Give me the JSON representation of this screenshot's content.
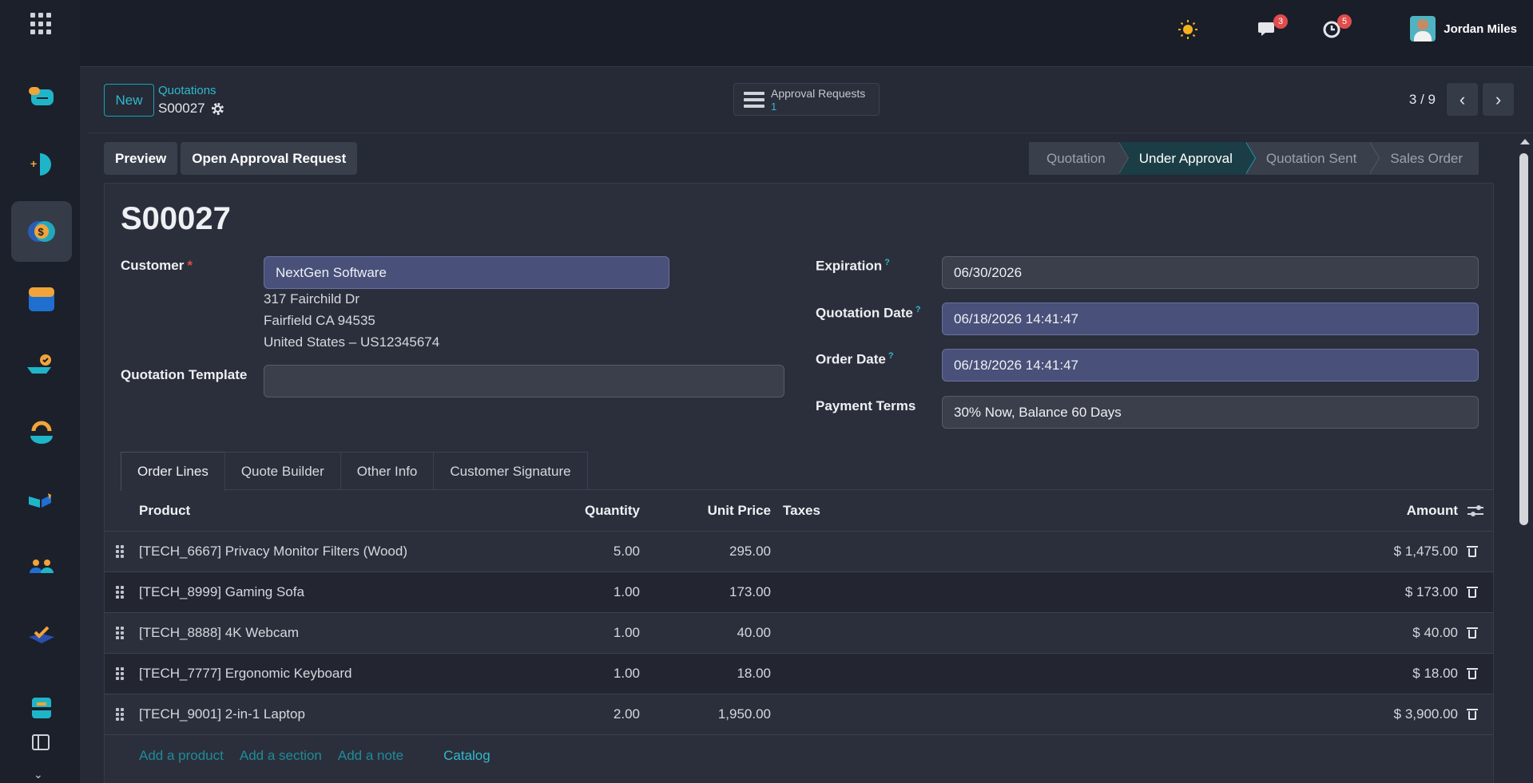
{
  "topbar": {
    "chat_badge": "3",
    "activity_badge": "5",
    "user_name": "Jordan Miles"
  },
  "cpanel": {
    "new_label": "New",
    "breadcrumb_parent": "Quotations",
    "breadcrumb_current": "S00027",
    "approval_label": "Approval Requests",
    "approval_count": "1",
    "pager_value": "3 / 9"
  },
  "actions": {
    "preview": "Preview",
    "open_approval": "Open Approval Request"
  },
  "status": {
    "stages": [
      "Quotation",
      "Under Approval",
      "Quotation Sent",
      "Sales Order"
    ],
    "current": "Under Approval"
  },
  "form": {
    "title": "S00027",
    "customer_label": "Customer",
    "customer_value": "NextGen Software",
    "address_line1": "317 Fairchild Dr",
    "address_line2": "Fairfield CA 94535",
    "address_line3": "United States – US12345674",
    "template_label": "Quotation Template",
    "template_value": "",
    "expiration_label": "Expiration",
    "expiration_value": "06/30/2026",
    "quotation_date_label": "Quotation Date",
    "quotation_date_value": "06/18/2026 14:41:47",
    "order_date_label": "Order Date",
    "order_date_value": "06/18/2026 14:41:47",
    "payment_terms_label": "Payment Terms",
    "payment_terms_value": "30% Now, Balance 60 Days",
    "help_mark": "?"
  },
  "tabs": [
    "Order Lines",
    "Quote Builder",
    "Other Info",
    "Customer Signature"
  ],
  "table": {
    "headers": {
      "product": "Product",
      "quantity": "Quantity",
      "unit_price": "Unit Price",
      "taxes": "Taxes",
      "amount": "Amount"
    },
    "rows": [
      {
        "product": "[TECH_6667] Privacy Monitor Filters (Wood)",
        "quantity": "5.00",
        "unit_price": "295.00",
        "taxes": "",
        "amount": "$ 1,475.00"
      },
      {
        "product": "[TECH_8999] Gaming Sofa",
        "quantity": "1.00",
        "unit_price": "173.00",
        "taxes": "",
        "amount": "$ 173.00"
      },
      {
        "product": "[TECH_8888] 4K Webcam",
        "quantity": "1.00",
        "unit_price": "40.00",
        "taxes": "",
        "amount": "$ 40.00"
      },
      {
        "product": "[TECH_7777] Ergonomic Keyboard",
        "quantity": "1.00",
        "unit_price": "18.00",
        "taxes": "",
        "amount": "$ 18.00"
      },
      {
        "product": "[TECH_9001] 2-in-1 Laptop",
        "quantity": "2.00",
        "unit_price": "1,950.00",
        "taxes": "",
        "amount": "$ 3,900.00"
      }
    ],
    "add_product": "Add a product",
    "add_section": "Add a section",
    "add_note": "Add a note",
    "catalog": "Catalog"
  },
  "colors": {
    "accent": "#17a2b8",
    "background": "#262a36",
    "sheet": "#2b2f3b",
    "highlight_input": "#495079",
    "badge": "#e04c4c"
  }
}
